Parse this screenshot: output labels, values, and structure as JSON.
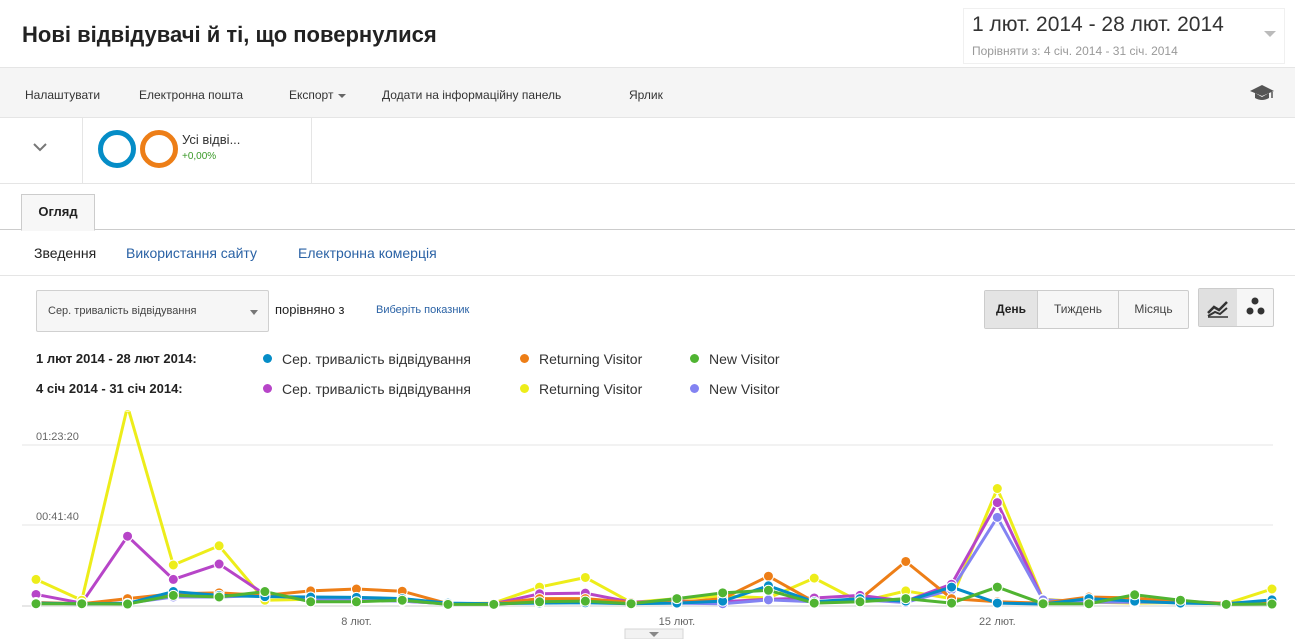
{
  "header": {
    "title": "Нові відвідувачі й ті, що повернулися",
    "date_range": "1 лют. 2014 - 28 лют. 2014",
    "compare_range": "Порівняти з: 4 січ. 2014 - 31 січ. 2014"
  },
  "toolbar": {
    "customize": "Налаштувати",
    "email": "Електронна пошта",
    "export": "Експорт",
    "add_dashboard": "Додати на інформаційну панель",
    "shortcut": "Ярлик",
    "icon": "graduation-cap-icon"
  },
  "segment": {
    "name": "Усі відві...",
    "delta": "+0,00%",
    "colors": [
      "#058dc7",
      "#ed7e17"
    ]
  },
  "tabs": {
    "overview": "Огляд"
  },
  "subtabs": {
    "summary": "Зведення",
    "site_usage": "Використання сайту",
    "ecommerce": "Електронна комерція"
  },
  "controls": {
    "metric": "Сер. тривалість відвідування",
    "compare_with": "порівняно з",
    "choose_metric": "Виберіть показник",
    "periods": [
      "День",
      "Тиждень",
      "Місяць"
    ],
    "active_period": "День",
    "view_icons": [
      "line-chart-icon",
      "motion-chart-icon"
    ]
  },
  "legend": {
    "current": {
      "date": "1 лют 2014 - 28 лют 2014:",
      "items": [
        {
          "label": "Сер. тривалість відвідування",
          "color": "#058dc7"
        },
        {
          "label": "Returning Visitor",
          "color": "#ed7e17"
        },
        {
          "label": "New Visitor",
          "color": "#50b432"
        }
      ]
    },
    "previous": {
      "date": "4 січ 2014 - 31 січ 2014:",
      "items": [
        {
          "label": "Сер. тривалість відвідування",
          "color": "#b745c8"
        },
        {
          "label": "Returning Visitor",
          "color": "#eded1a"
        },
        {
          "label": "New Visitor",
          "color": "#8383f2"
        }
      ]
    }
  },
  "chart_data": {
    "type": "line",
    "yticks": [
      "01:23:20",
      "00:41:40"
    ],
    "ylim": [
      0,
      5000
    ],
    "grid": true,
    "x_labels": [
      {
        "index": 7,
        "label": "8 лют."
      },
      {
        "index": 14,
        "label": "15 лют."
      },
      {
        "index": 21,
        "label": "22 лют."
      }
    ],
    "x": [
      "1",
      "2",
      "3",
      "4",
      "5",
      "6",
      "7",
      "8",
      "9",
      "10",
      "11",
      "12",
      "13",
      "14",
      "15",
      "16",
      "17",
      "18",
      "19",
      "20",
      "21",
      "22",
      "23",
      "24",
      "25",
      "26",
      "27",
      "28"
    ],
    "series": [
      {
        "name": "Сер. тривалість відвідування",
        "color": "#058dc7",
        "values": [
          60,
          40,
          50,
          420,
          300,
          260,
          250,
          240,
          200,
          60,
          40,
          60,
          70,
          40,
          60,
          120,
          600,
          100,
          200,
          120,
          560,
          60,
          30,
          200,
          120,
          60,
          40,
          160
        ]
      },
      {
        "name": "Returning Visitor",
        "color": "#ed7e17",
        "values": [
          80,
          40,
          200,
          350,
          380,
          300,
          440,
          500,
          430,
          40,
          40,
          200,
          200,
          80,
          80,
          200,
          900,
          100,
          180,
          1360,
          200,
          100,
          60,
          250,
          220,
          80,
          60,
          80
        ]
      },
      {
        "name": "New Visitor",
        "color": "#50b432",
        "values": [
          40,
          40,
          30,
          300,
          250,
          420,
          100,
          100,
          150,
          20,
          20,
          100,
          120,
          40,
          200,
          380,
          460,
          60,
          100,
          200,
          60,
          560,
          40,
          40,
          320,
          150,
          20,
          30
        ]
      },
      {
        "name": "Сер. тривалість відвідування",
        "color": "#b745c8",
        "values": [
          330,
          60,
          2150,
          800,
          1280,
          330,
          160,
          200,
          120,
          40,
          40,
          350,
          370,
          90,
          120,
          100,
          180,
          220,
          300,
          120,
          650,
          3200,
          160,
          90,
          90,
          120,
          50,
          60
        ]
      },
      {
        "name": "Returning Visitor",
        "color": "#eded1a",
        "values": [
          800,
          150,
          6210,
          1250,
          1850,
          150,
          180,
          220,
          200,
          40,
          60,
          560,
          860,
          80,
          200,
          280,
          220,
          840,
          100,
          440,
          200,
          3640,
          180,
          90,
          60,
          80,
          40,
          500
        ]
      },
      {
        "name": "New Visitor",
        "color": "#8383f2",
        "values": [
          60,
          40,
          60,
          250,
          250,
          300,
          200,
          160,
          120,
          40,
          40,
          120,
          110,
          60,
          60,
          40,
          160,
          100,
          160,
          80,
          480,
          2740,
          160,
          90,
          90,
          80,
          40,
          60
        ]
      }
    ]
  }
}
